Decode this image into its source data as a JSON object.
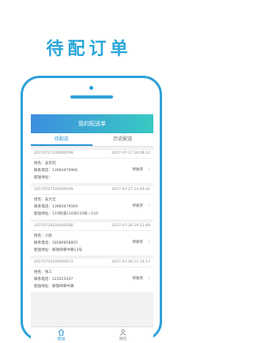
{
  "headline": "待配订单",
  "screen": {
    "title": "我的配送单",
    "tabs": [
      {
        "label": "待配送",
        "active": true
      },
      {
        "label": "历史配送",
        "active": false
      }
    ],
    "orders": [
      {
        "number": "20170727100000599",
        "time": "2017-07-27 16:08:12",
        "name_label": "姓名：",
        "name": "吴东钧",
        "phone_label": "联系电话：",
        "phone": "13983679966",
        "address_label": "配送地址：",
        "address": "",
        "status": "待收货"
      },
      {
        "number": "20170727100000599",
        "time": "2017-07-27 14:46:42",
        "name_label": "姓名：",
        "name": "吴大壮",
        "phone_label": "联系电话：",
        "phone": "13983679569",
        "address_label": "配送地址：",
        "address": "110街道110号110栋—110",
        "status": "待收货"
      },
      {
        "number": "20170726100000580",
        "time": "2017-07-26 19:52:08",
        "name_label": "姓名：",
        "name": "小赵",
        "phone_label": "联系电话：",
        "phone": "18589858855",
        "address_label": "配送地址：",
        "address": "解放碑邮中路13号",
        "status": "待收货"
      },
      {
        "number": "20170726100000572",
        "time": "2017-07-26 11:15:17",
        "name_label": "姓名：",
        "name": "张三",
        "phone_label": "联系电话：",
        "phone": "123525437",
        "address_label": "配送地址：",
        "address": "解放碑邮中路",
        "status": "待收货"
      }
    ],
    "nav": [
      {
        "label": "配送",
        "icon": "home-icon",
        "active": true
      },
      {
        "label": "我的",
        "icon": "person-icon",
        "active": false
      }
    ]
  }
}
